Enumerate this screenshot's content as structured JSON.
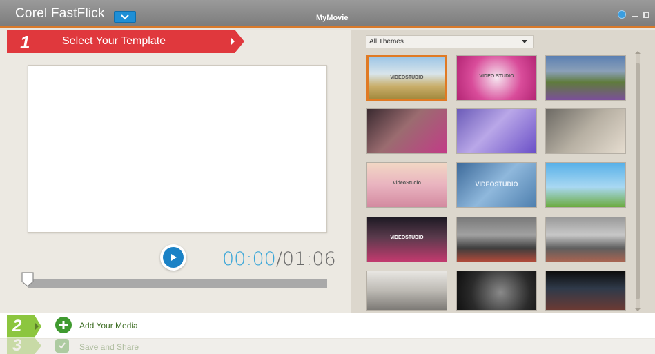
{
  "app": {
    "name": "Corel FastFlick",
    "document_title": "MyMovie"
  },
  "step1": {
    "number": "1",
    "label": "Select Your Template"
  },
  "player": {
    "current_time": "00:00",
    "separator": "/",
    "total_time": "01:06",
    "progress": 0
  },
  "themes": {
    "filter_value": "All Themes",
    "templates": [
      {
        "title": "VIDEOSTUDIO",
        "bg": "linear-gradient(#9ec6e6 0%, #d8e4ea 40%, #c9ae6a 70%, #a38a3e 100%)",
        "selected": true
      },
      {
        "title": "VIDEO STUDIO",
        "bg": "radial-gradient(circle at 50% 50%, #f6e6f0 0%, #d94c9a 55%, #b32574 100%)",
        "selected": false
      },
      {
        "title": "",
        "bg": "linear-gradient(#5b7fb2 0%, #8ba0b8 35%, #5f7b3c 60%, #7b4f9a 100%)",
        "selected": false
      },
      {
        "title": "",
        "bg": "linear-gradient(135deg, #3a2a30 0%, #9b6c70 45%, #c23b87 100%)",
        "selected": false
      },
      {
        "title": "",
        "bg": "linear-gradient(135deg, #6b5bb8 0%, #b9a7e8 45%, #6a4fc7 100%)",
        "selected": false
      },
      {
        "title": "",
        "bg": "linear-gradient(135deg, #6d6a64 0%, #b7b0a3 50%, #e6ddd0 100%)",
        "selected": false
      },
      {
        "title": "VideoStudio",
        "bg": "linear-gradient(#f2d7c4 0%, #e9b3bf 50%, #d38aa0 100%)",
        "selected": false
      },
      {
        "title": "VIDEOSTUDIO",
        "bg": "linear-gradient(135deg, #3d6a9a 0%, #8fb8dc 50%, #4e7fae 100%)",
        "selected": false
      },
      {
        "title": "",
        "bg": "linear-gradient(#57b0e8 0%, #a9d8f2 55%, #6bab3f 100%)",
        "selected": false
      },
      {
        "title": "VIDEOSTUDIO",
        "bg": "linear-gradient(#1e1a24 0%, #5a3a4c 45%, #c23a6e 100%)",
        "selected": false
      },
      {
        "title": "",
        "bg": "linear-gradient(#7a7a7a 0%, #a1a1a1 40%, #3d3d3d 70%, #b04a3a 100%)",
        "selected": false
      },
      {
        "title": "",
        "bg": "linear-gradient(#9a9a9a 0%, #c8c8c8 40%, #5e5e5e 70%, #a86452 100%)",
        "selected": false
      },
      {
        "title": "",
        "bg": "linear-gradient(#e8e6e2 0%, #bdbab4 50%, #7d7a76 100%)",
        "selected": false
      },
      {
        "title": "",
        "bg": "radial-gradient(circle at 55% 55%, #8a8a8a 0%, #2b2b2b 60%, #0e0e0e 100%)",
        "selected": false
      },
      {
        "title": "",
        "bg": "linear-gradient(#0d0d0d 0%, #2f3a4a 45%, #6b3a34 100%)",
        "selected": false
      }
    ]
  },
  "step2": {
    "number": "2",
    "label": "Add Your Media"
  },
  "step3": {
    "number": "3",
    "label": "Save and Share"
  }
}
